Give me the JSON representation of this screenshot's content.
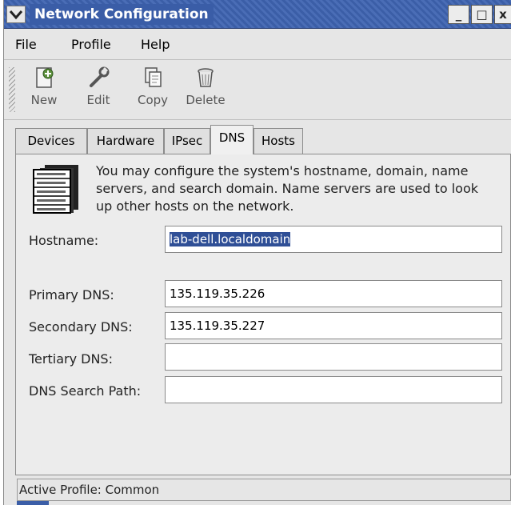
{
  "window": {
    "title": "Network Configuration",
    "minimize_glyph": "_",
    "maximize_glyph": "□",
    "close_glyph": "x"
  },
  "menu": {
    "file": "File",
    "profile": "Profile",
    "help": "Help"
  },
  "toolbar": {
    "new_label": "New",
    "edit_label": "Edit",
    "copy_label": "Copy",
    "delete_label": "Delete"
  },
  "tabs": [
    {
      "label": "Devices",
      "active": false
    },
    {
      "label": "Hardware",
      "active": false
    },
    {
      "label": "IPsec",
      "active": false
    },
    {
      "label": "DNS",
      "active": true
    },
    {
      "label": "Hosts",
      "active": false
    }
  ],
  "dns_panel": {
    "info_text": "You may configure the system's hostname, domain, name servers, and search domain. Name servers are used to look up other hosts on the network.",
    "hostname_label": "Hostname:",
    "hostname_value": "lab-dell.localdomain",
    "primary_dns_label": "Primary DNS:",
    "primary_dns_value": "135.119.35.226",
    "secondary_dns_label": "Secondary DNS:",
    "secondary_dns_value": "135.119.35.227",
    "tertiary_dns_label": "Tertiary DNS:",
    "tertiary_dns_value": "",
    "search_path_label": "DNS Search Path:",
    "search_path_value": ""
  },
  "status": {
    "active_profile": "Active Profile: Common"
  },
  "colors": {
    "titlebar": "#3b5ea7",
    "selection": "#2f4f96",
    "window_bg": "#e6e6e6"
  }
}
